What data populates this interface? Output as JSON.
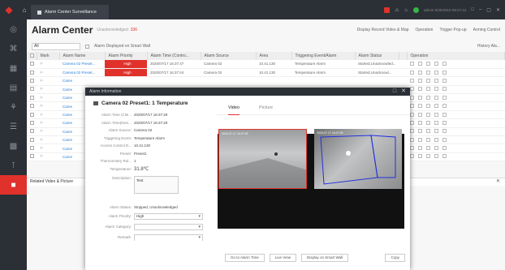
{
  "app": {
    "tab_title": "Alarm Center Surveillance",
    "colors": {
      "accent": "#e0322b",
      "titlebar": "#2b2f36",
      "link": "#2a7fd4",
      "ok": "#3bb54a"
    }
  },
  "topbar": {
    "right_text": "admin  5/30/2019 09:27:41"
  },
  "sidebar": {
    "icons": [
      "globe-icon",
      "puzzle-icon",
      "grid-icon",
      "monitor-icon",
      "person-icon",
      "layers-icon",
      "chart-icon",
      "alarm-icon"
    ]
  },
  "header": {
    "title": "Alarm Center",
    "subtitle": "Unacknowledged",
    "badge": "336",
    "actions": [
      "Display Record Video & Map",
      "Operation",
      "Trigger Pop-up",
      "Arming Control"
    ]
  },
  "filter": {
    "select_value": "All",
    "checkbox_label": "Alarm Displayed on Smart Wall",
    "history_label": "History Ala..."
  },
  "table": {
    "columns": [
      "Mark",
      "Alarm Name",
      "Alarm Priority",
      "Alarm Time (Contro...",
      "Alarm Source",
      "Area",
      "Triggering Event/Alarm",
      "Alarm Status",
      "",
      "Operation"
    ],
    "rows": [
      {
        "name": "Camera 02 Preset...",
        "priority": "High",
        "time": "2020/07/17 16:37:47",
        "source": "Camera 02",
        "area": "10.41.130",
        "event": "Temperature Alarm",
        "status": "Started,Unacknowled..."
      },
      {
        "name": "Camera 02 Preset...",
        "priority": "High",
        "time": "2020/07/17 16:37:44",
        "source": "Camera 02",
        "area": "10.41.130",
        "event": "Temperature Alarm",
        "status": "Started,Unacknowl..."
      },
      {
        "name": "Came",
        "priority": "",
        "time": "",
        "source": "",
        "area": "",
        "event": "",
        "status": ""
      },
      {
        "name": "Came",
        "priority": "",
        "time": "",
        "source": "",
        "area": "",
        "event": "",
        "status": ""
      },
      {
        "name": "Came",
        "priority": "",
        "time": "",
        "source": "",
        "area": "",
        "event": "",
        "status": ""
      },
      {
        "name": "Came",
        "priority": "",
        "time": "",
        "source": "",
        "area": "",
        "event": "",
        "status": ""
      },
      {
        "name": "Came",
        "priority": "",
        "time": "",
        "source": "",
        "area": "",
        "event": "",
        "status": ""
      },
      {
        "name": "Came",
        "priority": "",
        "time": "",
        "source": "",
        "area": "",
        "event": "",
        "status": ""
      },
      {
        "name": "Came",
        "priority": "",
        "time": "",
        "source": "",
        "area": "",
        "event": "",
        "status": ""
      },
      {
        "name": "Came",
        "priority": "",
        "time": "",
        "source": "",
        "area": "",
        "event": "",
        "status": ""
      },
      {
        "name": "Came",
        "priority": "",
        "time": "",
        "source": "",
        "area": "",
        "event": "",
        "status": ""
      },
      {
        "name": "Came",
        "priority": "",
        "time": "",
        "source": "",
        "area": "",
        "event": "",
        "status": ""
      }
    ]
  },
  "related_label": "Related Video & Picture",
  "modal": {
    "bar_title": "Alarm Information",
    "heading": "Camera 02 Preset1: 1 Temperature",
    "fields": [
      {
        "k": "Alarm Time (Clie...",
        "v": "2020/07/17 16:37:29"
      },
      {
        "k": "Alarm Time(Devi...",
        "v": "2020/07/17 16:37:29"
      },
      {
        "k": "Alarm Source:",
        "v": "Camera 02"
      },
      {
        "k": "Triggering Event:",
        "v": "Temperature Alarm"
      },
      {
        "k": "Access Control D...",
        "v": "10.41.130"
      },
      {
        "k": "Preset:",
        "v": "Preset1"
      },
      {
        "k": "Thermometry Rul...",
        "v": "1"
      }
    ],
    "temperature_label": "Temperature:",
    "temperature_value": "31.8℃",
    "description_label": "Description:",
    "description_value": "Test",
    "status_label": "Alarm Status:",
    "status_value": "Stopped, Unacknowledged",
    "priority_label": "Alarm Priority:",
    "priority_value": "High",
    "category_label": "Alarm Category:",
    "category_value": "",
    "remark_label": "Remark:",
    "tabs": [
      "Video",
      "Picture"
    ],
    "video_labels": [
      "2020-07-17 16:37:29",
      "2020-07-17 16:37:29"
    ],
    "buttons": [
      "Go to Alarm Time",
      "Live View",
      "Display on Smart Wall"
    ],
    "copy_button": "Copy"
  }
}
